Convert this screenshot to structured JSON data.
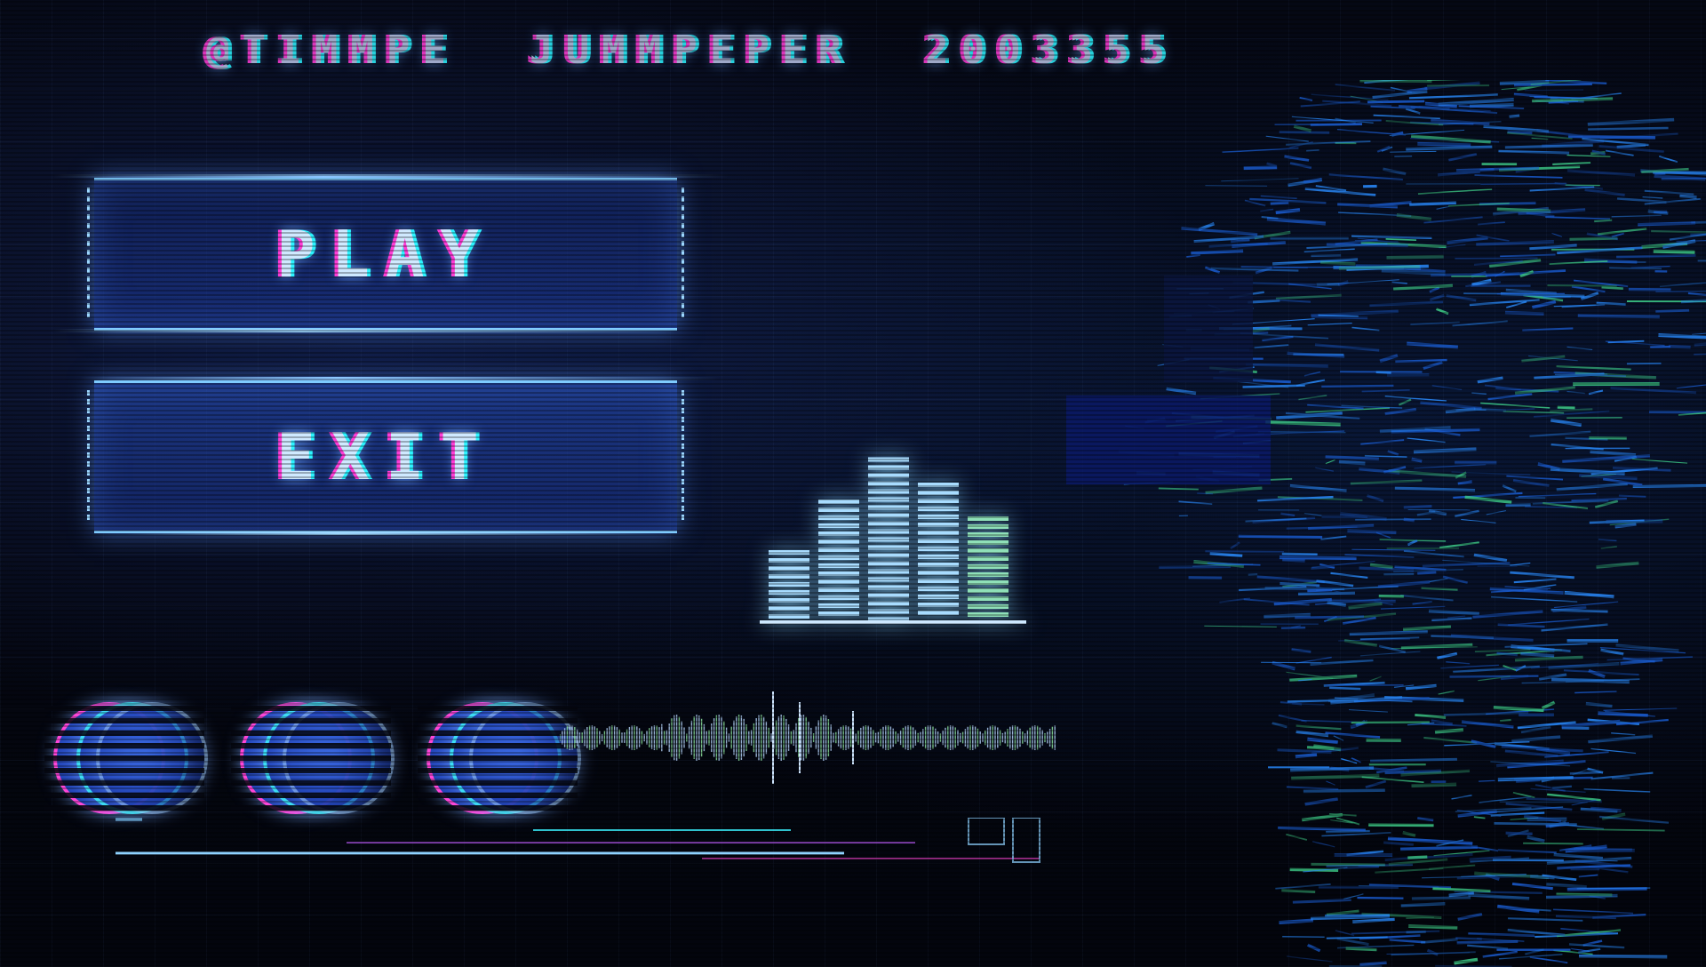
{
  "header": {
    "left": "@TIMMPE",
    "middle": "JUMMPEPER",
    "right": "2003355"
  },
  "menu": {
    "play_label": "PLAY",
    "exit_label": "EXIT"
  },
  "lives": {
    "count": 3
  },
  "signal": {
    "bar_levels": [
      0.4,
      0.7,
      0.95,
      0.8,
      0.6
    ]
  },
  "colors": {
    "accent_cyan": "#2cf3ff",
    "accent_magenta": "#ff3cd6",
    "glow_blue": "#3e6ee8",
    "background": "#04060f"
  }
}
